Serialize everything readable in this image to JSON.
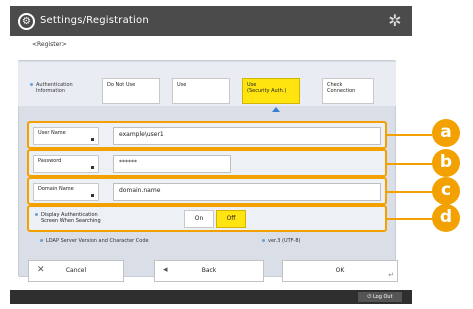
{
  "header": {
    "title": "Settings/Registration",
    "subtitle": "<Register>"
  },
  "auth": {
    "label_line1": "Authentication",
    "label_line2": "Information",
    "options": [
      {
        "label_line1": "Do Not Use",
        "label_line2": ""
      },
      {
        "label_line1": "Use",
        "label_line2": ""
      },
      {
        "label_line1": "Use",
        "label_line2": "(Security Auth.)"
      },
      {
        "label_line1": "Check",
        "label_line2": "Connection"
      }
    ],
    "selected_index": 2
  },
  "fields": {
    "user_name": {
      "label": "User Name",
      "value": "example\\user1"
    },
    "password": {
      "label": "Password",
      "value": "******"
    },
    "domain_name": {
      "label": "Domain Name",
      "value": "domain.name"
    }
  },
  "display_auth": {
    "label_line1": "Display Authentication",
    "label_line2": "Screen When Searching",
    "on_label": "On",
    "off_label": "Off",
    "selected": "Off"
  },
  "ldap": {
    "label": "LDAP Server Version and Character Code",
    "value": "ver.3 (UTF-8)"
  },
  "callouts": [
    "a",
    "b",
    "c",
    "d"
  ],
  "buttons": {
    "cancel": "Cancel",
    "back": "Back",
    "ok": "OK"
  },
  "footer": {
    "logout": "Log Out"
  },
  "colors": {
    "accent": "#f2a100",
    "selected": "#ffe40f",
    "header": "#4b4b4b"
  }
}
